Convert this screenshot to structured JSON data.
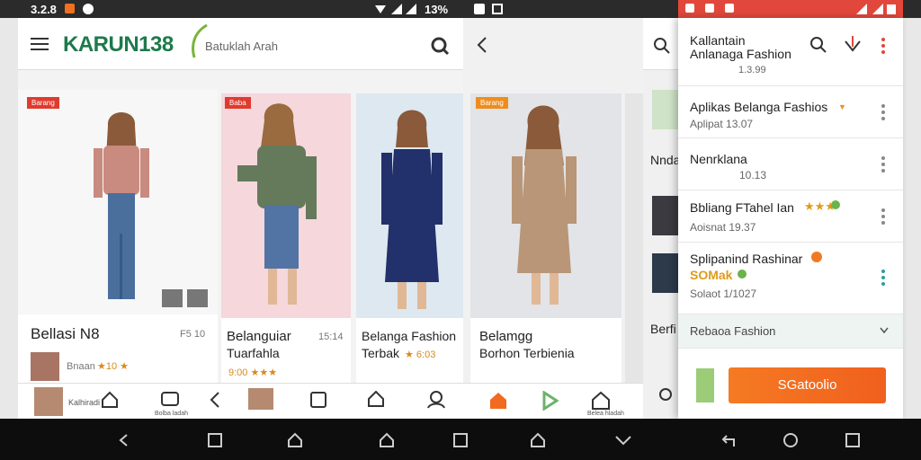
{
  "status_bar": {
    "time": "3.2.8",
    "time_center": "13%"
  },
  "screen1": {
    "logo": "KARUN138",
    "search_placeholder": "Batuklah Arah",
    "cards": [
      {
        "badge": "Barang",
        "title": "Bellasi N8",
        "price": "F5 10",
        "sub_text": "Bnaan",
        "rating_text": "★10 ★"
      },
      {
        "badge": "Baba",
        "title": "Belanguiar",
        "title2": "Tuarfahla",
        "price": "15:14",
        "rating_text": "9:00 ★★★"
      },
      {
        "title": "Belanga Fashion",
        "title2": "Terbak",
        "rating_text": "★ 6:03"
      }
    ],
    "nav_labels": {
      "home": "Kalhiradi",
      "tv": "Bolba ladah"
    }
  },
  "screen2": {
    "badge": "Barang",
    "title": "Belamgg",
    "title2": "Borhon Terbienia",
    "nav_label": "Belea hladah"
  },
  "screen3": {
    "text1": "Nnda",
    "text2": "Berfi"
  },
  "drawer": {
    "header_title": "Kallantain",
    "header_title2": "Anlanaga Fashion",
    "header_sub": "1.3.99",
    "items": [
      {
        "title": "Aplikas Belanga Fashios",
        "sub": "Aplipat 13.07",
        "active": true
      },
      {
        "title": "Nenrklana",
        "sub": "10.13"
      },
      {
        "title": "Bbliang FTahel Ian",
        "sub": "Aoisnat 19.37"
      },
      {
        "title": "Splipanind Rashinar",
        "title2": "SOMak",
        "sub": "Solaot 1/1027"
      }
    ],
    "footer_item": "Rebaoa Fashion",
    "button_label": "SGatoolio"
  },
  "colors": {
    "accent_orange": "#f06a22",
    "brand_green": "#1d7a4b",
    "status_red": "#e1483b",
    "badge_red": "#e03a2e",
    "badge_orange": "#ef8d1c"
  }
}
